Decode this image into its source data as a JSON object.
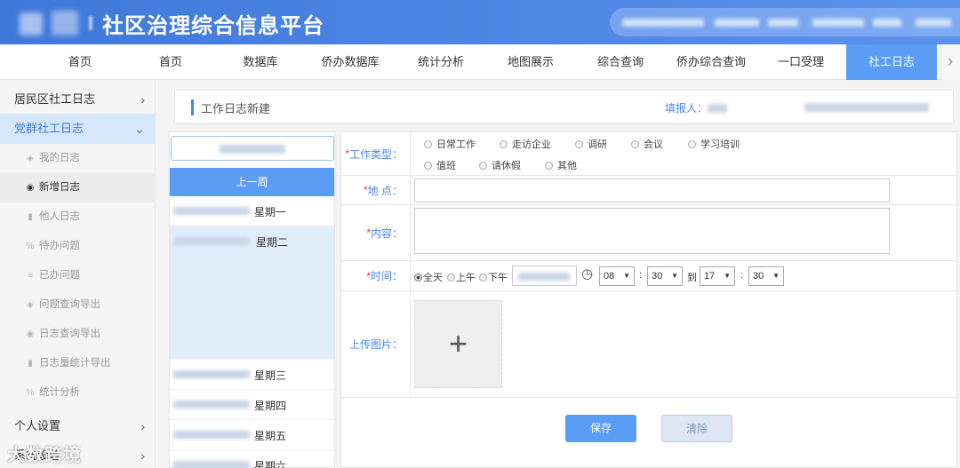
{
  "header": {
    "title": "社区治理综合信息平台"
  },
  "nav": {
    "items": [
      "首页",
      "首页",
      "数据库",
      "侨办数据库",
      "统计分析",
      "地图展示",
      "综合查询",
      "侨办综合查询",
      "一口受理",
      "社工日志"
    ],
    "active_index": 9
  },
  "sidebar": {
    "group1": "居民区社工日志",
    "group2": "党群社工日志",
    "items": [
      "我的日志",
      "新增日志",
      "他人日志",
      "待办问题",
      "已办问题",
      "问题查询导出",
      "日志查询导出",
      "日志量统计导出",
      "统计分析"
    ],
    "active_index": 1,
    "group3": "个人设置",
    "group4": "系统设置"
  },
  "page": {
    "title": "工作日志新建",
    "reporter_label": "填报人："
  },
  "week": {
    "prev_label": "上一周",
    "days": [
      "星期一",
      "星期二",
      "星期三",
      "星期四",
      "星期五",
      "星期六"
    ],
    "selected_index": 1
  },
  "form": {
    "type_label": "工作类型：",
    "type_options": [
      "日常工作",
      "走访企业",
      "调研",
      "会议",
      "学习培训",
      "值班",
      "请休假",
      "其他"
    ],
    "place_label": "地 点：",
    "content_label": "内容：",
    "time_label": "时间：",
    "time_options": [
      "全天",
      "上午",
      "下午"
    ],
    "time_selected": "全天",
    "start_hour": "08",
    "start_min": "30",
    "to_label": "到",
    "end_hour": "17",
    "end_min": "30",
    "colon": ":",
    "upload_label": "上传图片：",
    "upload_plus": "+",
    "required_mark": "*"
  },
  "buttons": {
    "save": "保存",
    "clear": "清除"
  },
  "watermark": "大数跨境",
  "colors": {
    "brand": "#4a86e8",
    "active_nav": "#5b9cf4",
    "required": "#e33333"
  }
}
